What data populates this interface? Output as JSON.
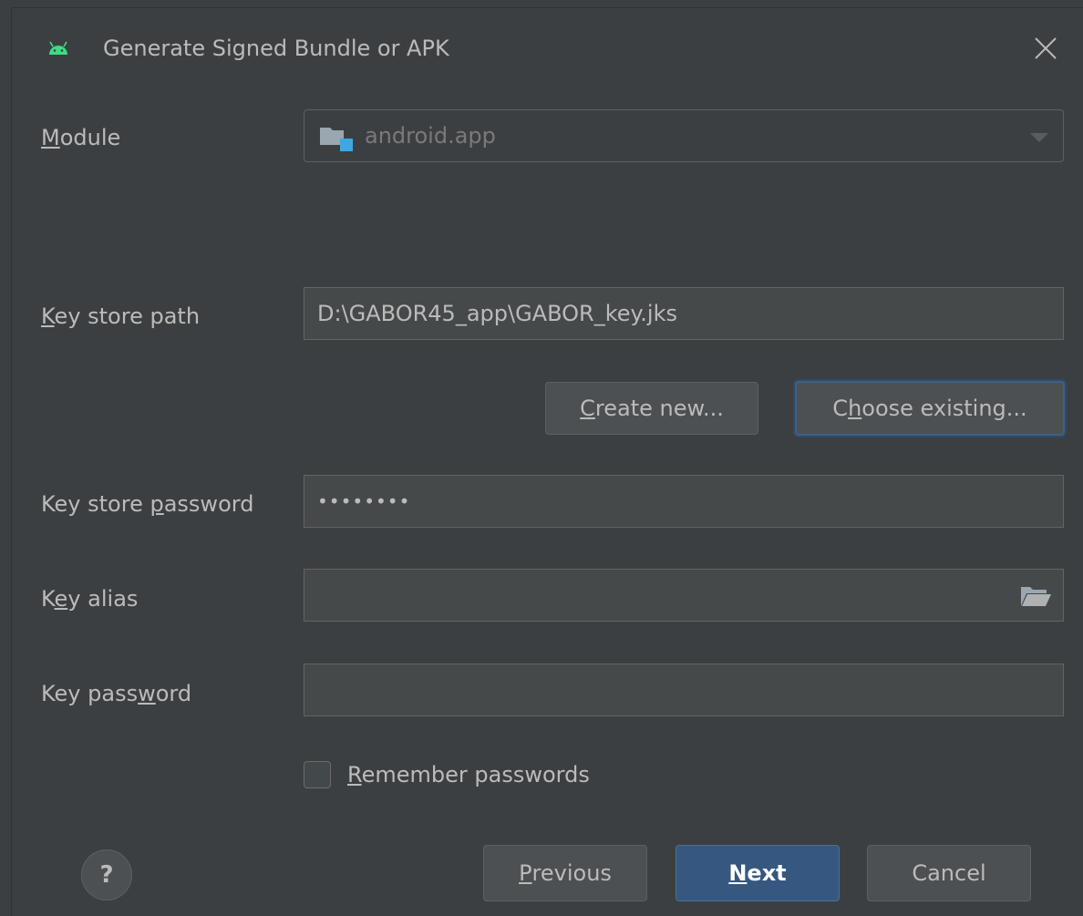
{
  "window": {
    "title": "Generate Signed Bundle or APK",
    "app_icon": "android-icon",
    "close_icon": "close-icon"
  },
  "module": {
    "label_prefix": "",
    "label_mnemonic": "M",
    "label_suffix": "odule",
    "value": "android.app",
    "icon": "module-folder-icon"
  },
  "key_store_path": {
    "label_prefix": "",
    "label_mnemonic": "K",
    "label_suffix": "ey store path",
    "value": "D:\\GABOR45_app\\GABOR_key.jks"
  },
  "buttons": {
    "create_new": {
      "prefix": "",
      "mnemonic": "C",
      "suffix": "reate new..."
    },
    "choose_existing": {
      "prefix": "C",
      "mnemonic": "h",
      "suffix": "oose existing..."
    },
    "previous": {
      "prefix": "",
      "mnemonic": "P",
      "suffix": "revious"
    },
    "next": {
      "prefix": "",
      "mnemonic": "N",
      "suffix": "ext"
    },
    "cancel": "Cancel",
    "help": "?"
  },
  "key_store_password": {
    "label_prefix": "Key store ",
    "label_mnemonic": "p",
    "label_suffix": "assword",
    "value": "••••••••"
  },
  "key_alias": {
    "label_prefix": "K",
    "label_mnemonic": "e",
    "label_suffix": "y alias",
    "value": "",
    "browse_icon": "folder-open-icon"
  },
  "key_password": {
    "label_prefix": "Key pass",
    "label_mnemonic": "w",
    "label_suffix": "ord",
    "value": ""
  },
  "remember": {
    "checked": false,
    "label_prefix": "",
    "label_mnemonic": "R",
    "label_suffix": "emember passwords"
  },
  "colors": {
    "background": "#3c3f41",
    "field_background": "#45494a",
    "primary_button": "#365880",
    "focus_ring": "#3d6185",
    "android_green": "#3ddc84",
    "module_accent": "#40a7e3"
  }
}
